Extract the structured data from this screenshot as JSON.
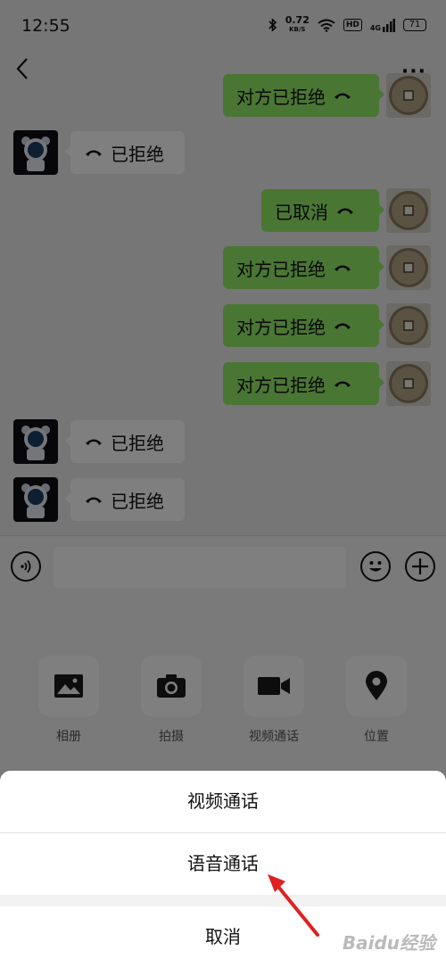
{
  "status_bar": {
    "time": "12:55",
    "net_speed_value": "0.72",
    "net_speed_unit": "KB/S",
    "hd_label": "HD",
    "signal_label": "4G",
    "battery": "71"
  },
  "messages": [
    {
      "side": "right",
      "text": "对方已拒绝"
    },
    {
      "side": "left",
      "text": "已拒绝"
    },
    {
      "side": "right",
      "text": "已取消"
    },
    {
      "side": "right",
      "text": "对方已拒绝"
    },
    {
      "side": "right",
      "text": "对方已拒绝"
    },
    {
      "side": "right",
      "text": "对方已拒绝"
    },
    {
      "side": "left",
      "text": "已拒绝"
    },
    {
      "side": "left",
      "text": "已拒绝"
    }
  ],
  "panel": {
    "album": "相册",
    "camera": "拍摄",
    "video_call": "视频通话",
    "location": "位置"
  },
  "sheet": {
    "video_call": "视频通话",
    "voice_call": "语音通话",
    "cancel": "取消"
  },
  "watermark": "Baidu经验",
  "colors": {
    "outgoing_bubble": "#95ec69",
    "incoming_bubble": "#ffffff",
    "annotation_arrow": "#e02020"
  }
}
